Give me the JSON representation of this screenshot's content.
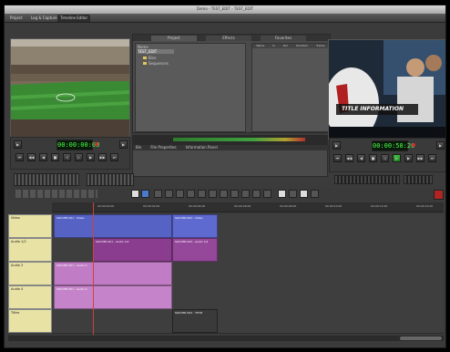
{
  "window": {
    "title": "Demo - TEST_EDIT - TEST_EDIT"
  },
  "menu": {
    "tabs": [
      "Project",
      "Log & Capture",
      "Timeline Editor"
    ],
    "active_index": 2
  },
  "browser": {
    "tabs": [
      "Project",
      "Effects",
      "Favorites"
    ],
    "tree_header": "Name",
    "tree_items": [
      "TEST_EDIT",
      "Bins",
      "Sequences"
    ],
    "list_columns": [
      "Name",
      "In",
      "Dur",
      "Duration",
      "Tracks"
    ]
  },
  "source": {
    "timecode": "00:00:00:00"
  },
  "record": {
    "timecode": "00:00:58:20",
    "title_overlay": "TITLE INFORMATION"
  },
  "info": {
    "columns": [
      "Bin",
      "File Properties",
      "Information Panel"
    ]
  },
  "timeline": {
    "ruler_labels": [
      "00:00:00:00",
      "00:00:02:00",
      "00:00:04:00",
      "00:00:06:00",
      "00:00:08:00",
      "00:00:10:00",
      "00:00:12:00",
      "00:00:14:00",
      "00:00:16:00"
    ],
    "tracks": [
      {
        "name": "Video"
      },
      {
        "name": "Audio 1/2"
      },
      {
        "name": "Audio 3"
      },
      {
        "name": "Audio 4"
      },
      {
        "name": "Titles"
      }
    ],
    "clips": [
      {
        "track": 0,
        "label": "SOCCER 001 - Video"
      },
      {
        "track": 0,
        "label": "SOCCER 002 - Video"
      },
      {
        "track": 1,
        "label": "SOCCER 001 - Audio 1/2"
      },
      {
        "track": 1,
        "label": "SOCCER 002 - Audio 1/2"
      },
      {
        "track": 2,
        "label": "SOCCER 001 - Audio 3"
      },
      {
        "track": 3,
        "label": "SOCCER 001 - Audio 4"
      },
      {
        "track": 4,
        "label": "SOCCER 002 - TITLE"
      }
    ]
  },
  "colors": {
    "video_clip": "#5662c4",
    "audio12_clip": "#8a3d8e",
    "audio34_clip": "#c07cc4",
    "title_clip": "#3a3a3a",
    "playhead": "#d04040",
    "lcd_text": "#4cff4c"
  }
}
